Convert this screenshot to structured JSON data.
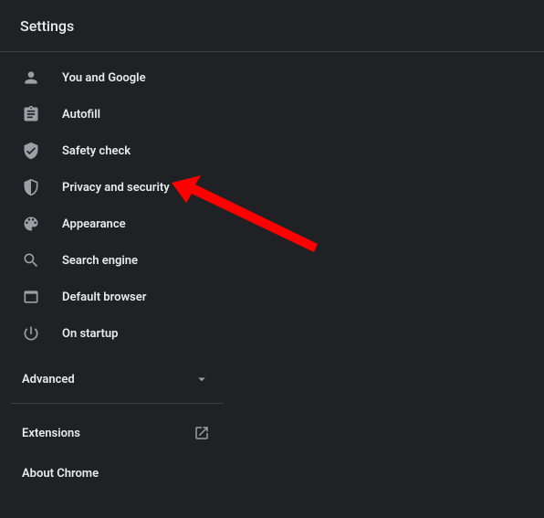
{
  "header": {
    "title": "Settings"
  },
  "sidebar": {
    "items": [
      {
        "label": "You and Google",
        "icon": "person-icon"
      },
      {
        "label": "Autofill",
        "icon": "clipboard-icon"
      },
      {
        "label": "Safety check",
        "icon": "shield-check-icon"
      },
      {
        "label": "Privacy and security",
        "icon": "shield-icon"
      },
      {
        "label": "Appearance",
        "icon": "palette-icon"
      },
      {
        "label": "Search engine",
        "icon": "search-icon"
      },
      {
        "label": "Default browser",
        "icon": "browser-icon"
      },
      {
        "label": "On startup",
        "icon": "power-icon"
      }
    ],
    "advanced_label": "Advanced",
    "extensions_label": "Extensions",
    "about_label": "About Chrome"
  },
  "annotation": {
    "arrow_target": "Privacy and security",
    "arrow_color": "#ff0000"
  }
}
